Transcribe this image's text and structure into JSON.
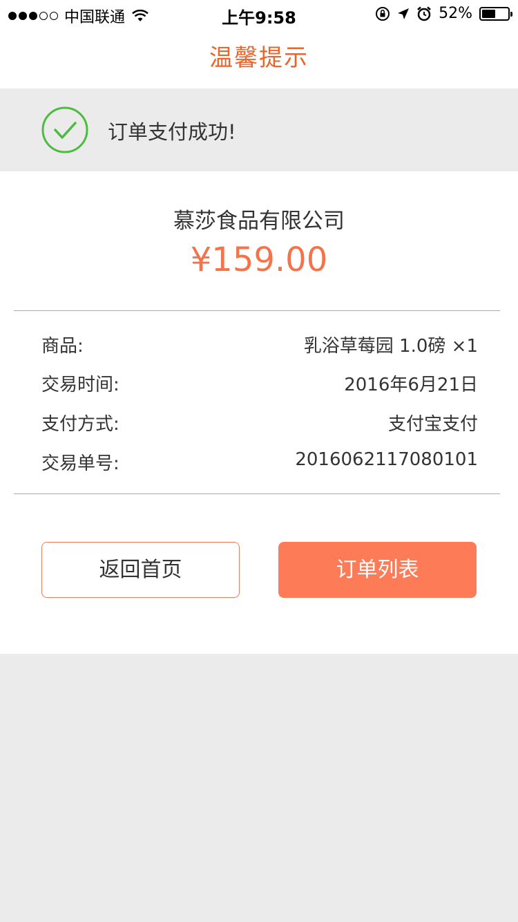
{
  "status_bar": {
    "carrier": "中国联通",
    "time": "上午9:58",
    "battery_percent": "52%",
    "battery_level": 0.52,
    "signal_bars_filled": 3,
    "signal_bars_total": 5,
    "icons": [
      "wifi-icon",
      "orientation-lock-icon",
      "location-icon",
      "alarm-icon",
      "battery-icon"
    ]
  },
  "nav": {
    "title": "温馨提示"
  },
  "banner": {
    "message": "订单支付成功!",
    "icon": "check-circle-icon"
  },
  "payment": {
    "merchant": "慕莎食品有限公司",
    "amount": "¥159.00"
  },
  "details": [
    {
      "label": "商品:",
      "value": "乳浴草莓园 1.0磅 ×1"
    },
    {
      "label": "交易时间:",
      "value": "2016年6月21日"
    },
    {
      "label": "支付方式:",
      "value": "支付宝支付"
    },
    {
      "label": "交易单号:",
      "value": "2016062117080101"
    }
  ],
  "actions": {
    "home_label": "返回首页",
    "orders_label": "订单列表"
  },
  "colors": {
    "accent": "#e9652c",
    "amount": "#f5734a",
    "primary_button": "#fe7b57",
    "success": "#4cbb3f",
    "background": "#ebebeb"
  }
}
